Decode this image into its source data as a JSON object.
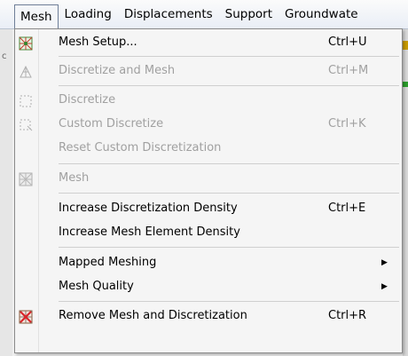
{
  "menubar": {
    "items": [
      {
        "label": "Mesh"
      },
      {
        "label": "Loading"
      },
      {
        "label": "Displacements"
      },
      {
        "label": "Support"
      },
      {
        "label": "Groundwate"
      }
    ]
  },
  "background": {
    "left_fragment": "c"
  },
  "menu": {
    "items": [
      {
        "label": "Mesh Setup...",
        "shortcut": "Ctrl+U",
        "enabled": true,
        "icon": "mesh-setup-icon"
      },
      {
        "label": "Discretize and Mesh",
        "shortcut": "Ctrl+M",
        "enabled": false,
        "icon": "discretize-mesh-icon"
      },
      {
        "label": "Discretize",
        "shortcut": "",
        "enabled": false,
        "icon": "discretize-icon"
      },
      {
        "label": "Custom Discretize",
        "shortcut": "Ctrl+K",
        "enabled": false,
        "icon": "custom-discretize-icon"
      },
      {
        "label": "Reset Custom Discretization",
        "shortcut": "",
        "enabled": false,
        "icon": ""
      },
      {
        "label": "Mesh",
        "shortcut": "",
        "enabled": false,
        "icon": "mesh-icon"
      },
      {
        "label": "Increase Discretization Density",
        "shortcut": "Ctrl+E",
        "enabled": true,
        "icon": ""
      },
      {
        "label": "Increase Mesh Element Density",
        "shortcut": "",
        "enabled": true,
        "icon": ""
      },
      {
        "label": "Mapped Meshing",
        "shortcut": "",
        "enabled": true,
        "icon": "",
        "submenu": true
      },
      {
        "label": "Mesh Quality",
        "shortcut": "",
        "enabled": true,
        "icon": "",
        "submenu": true
      },
      {
        "label": "Remove Mesh and Discretization",
        "shortcut": "Ctrl+R",
        "enabled": true,
        "icon": "remove-mesh-icon"
      }
    ],
    "submenu_arrow": "▶"
  }
}
